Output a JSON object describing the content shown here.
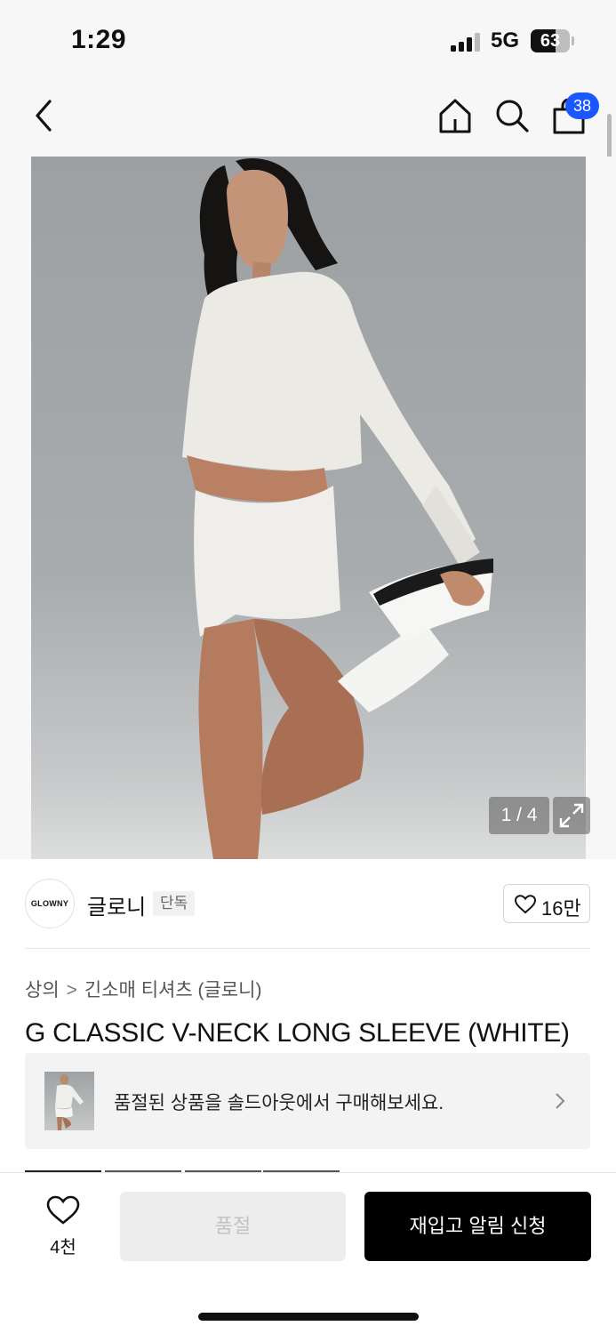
{
  "status_bar": {
    "time": "1:29",
    "network": "5G",
    "battery_percent": 63,
    "battery_label": "63"
  },
  "header": {
    "back_icon": "chevron-left-icon",
    "home_icon": "home-icon",
    "search_icon": "search-icon",
    "cart_icon": "shopping-bag-icon",
    "cart_count": "38"
  },
  "gallery": {
    "counter": "1 / 4",
    "expand_icon": "expand-icon"
  },
  "brand": {
    "logo_text": "GLOWNY",
    "name": "글로니",
    "tag": "단독",
    "like_count": "16만"
  },
  "product": {
    "breadcrumb": [
      "상의",
      "긴소매 티셔츠 (글로니)"
    ],
    "title": "G CLASSIC V-NECK LONG SLEEVE (WHITE)"
  },
  "soldout_banner": {
    "text": "품절된 상품을 솔드아웃에서 구매해보세요."
  },
  "bottom_bar": {
    "wish_count": "4천",
    "soldout_label": "품절",
    "restock_label": "재입고 알림 신청"
  },
  "colors": {
    "accent_blue": "#1a57ff",
    "primary_button": "#000000",
    "disabled_button": "#ededed"
  }
}
